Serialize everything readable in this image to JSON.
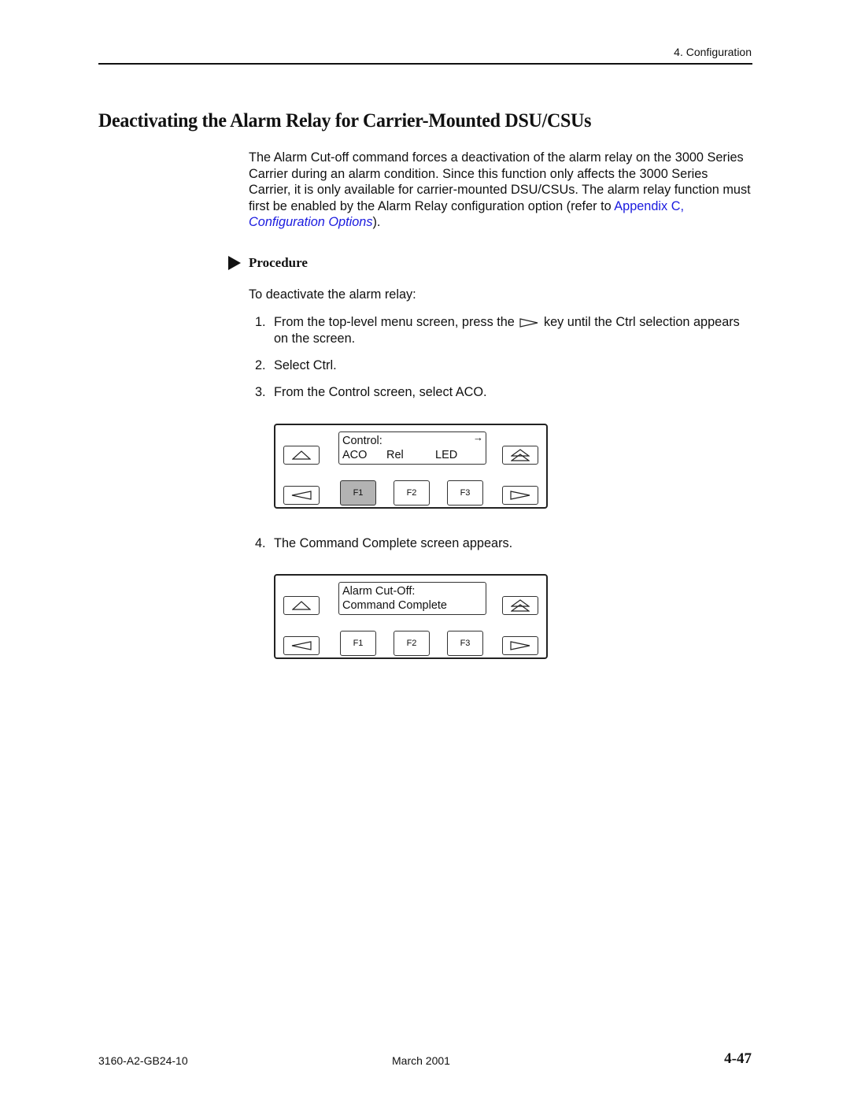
{
  "header": {
    "running_head": "4. Configuration"
  },
  "section": {
    "title": "Deactivating the Alarm Relay for Carrier-Mounted DSU/CSUs",
    "intro": {
      "text": "The Alarm Cut-off command forces a deactivation of the alarm relay on the 3000 Series Carrier during an alarm condition. Since this function only affects the 3000 Series Carrier, it is only available for carrier-mounted DSU/CSUs. The alarm relay function must first be enabled by the Alarm Relay configuration option (refer to ",
      "link_prefix": "Appendix C, ",
      "link_italic": "Configuration Options",
      "suffix": ")."
    }
  },
  "procedure": {
    "heading": "Procedure",
    "lead": "To deactivate the alarm relay:",
    "steps": [
      {
        "num": "1.",
        "before": "From the top-level menu screen, press the",
        "icon": "right-arrow-key-icon",
        "after": "key until the Ctrl selection appears on the screen."
      },
      {
        "num": "2.",
        "text": "Select Ctrl."
      },
      {
        "num": "3.",
        "text": "From the Control screen, select ACO."
      },
      {
        "num": "4.",
        "text": "The Command Complete screen appears."
      }
    ]
  },
  "panels": [
    {
      "lcd_line1": "Control:",
      "lcd_line2": [
        "ACO",
        "Rel",
        "LED"
      ],
      "scroll_indicator": "→",
      "function_keys": [
        "F1",
        "F2",
        "F3"
      ],
      "active_key": "F1"
    },
    {
      "lcd_line1": "Alarm Cut-Off:",
      "lcd_line2": [
        "Command Complete"
      ],
      "function_keys": [
        "F1",
        "F2",
        "F3"
      ],
      "active_key": ""
    }
  ],
  "footer": {
    "doc_number": "3160-A2-GB24-10",
    "date": "March 2001",
    "page_number": "4-47"
  }
}
